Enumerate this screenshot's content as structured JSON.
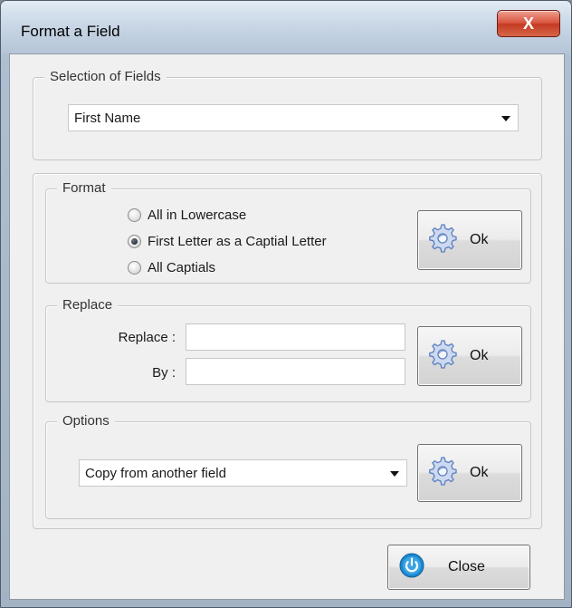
{
  "window": {
    "title": "Format a Field",
    "close_glyph": "X"
  },
  "selection": {
    "legend": "Selection of Fields",
    "selected_value": "First Name"
  },
  "format": {
    "legend": "Format",
    "options": [
      {
        "label": "All in Lowercase",
        "checked": false
      },
      {
        "label": "First Letter as a Captial Letter",
        "checked": true
      },
      {
        "label": "All Captials",
        "checked": false
      }
    ],
    "ok_label": "Ok"
  },
  "replace": {
    "legend": "Replace",
    "replace_label": "Replace :",
    "replace_value": "",
    "by_label": "By :",
    "by_value": "",
    "ok_label": "Ok"
  },
  "options": {
    "legend": "Options",
    "selected_value": "Copy from another field",
    "ok_label": "Ok"
  },
  "footer": {
    "close_label": "Close"
  },
  "icons": {
    "ok": "gear-icon",
    "close": "power-icon"
  },
  "colors": {
    "gear": "#5b7fc0",
    "power": "#1e88d0",
    "title_close": "#c9442c"
  }
}
